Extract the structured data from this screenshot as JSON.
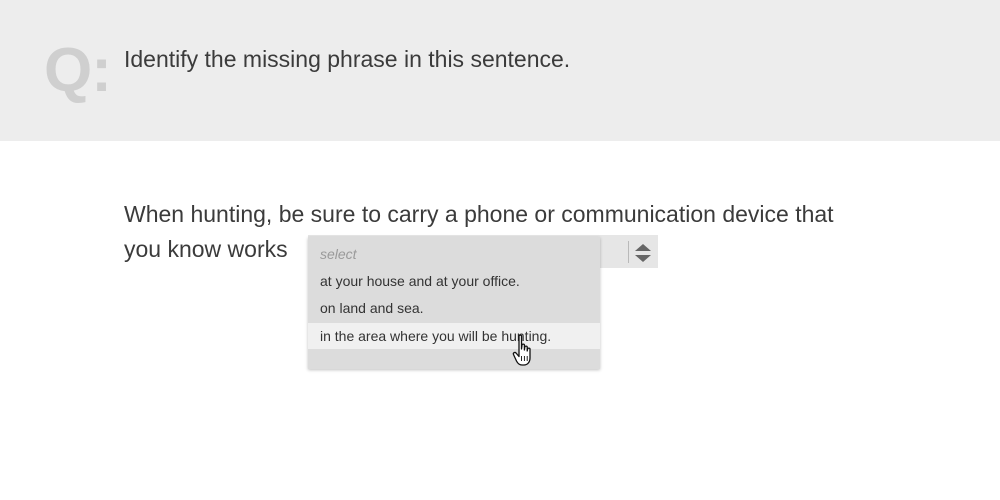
{
  "header": {
    "q_label": "Q:",
    "question": "Identify the missing phrase in this sentence."
  },
  "sentence": {
    "line1": "When hunting, be sure to carry a phone or communication device that",
    "line2": "you know works"
  },
  "dropdown": {
    "placeholder": "select",
    "options": [
      "at your house and at your office.",
      "on land and sea.",
      "in the area where you will be hunting."
    ],
    "hovered_index": 2,
    "stepper_icon": "up-down-chevron-icon"
  },
  "colors": {
    "header_bg": "#ededed",
    "q_mark": "#cfcfcf",
    "text": "#3b3b3b",
    "dropdown_bg": "#dcdcdc",
    "hover_bg": "#f0f0f0"
  }
}
